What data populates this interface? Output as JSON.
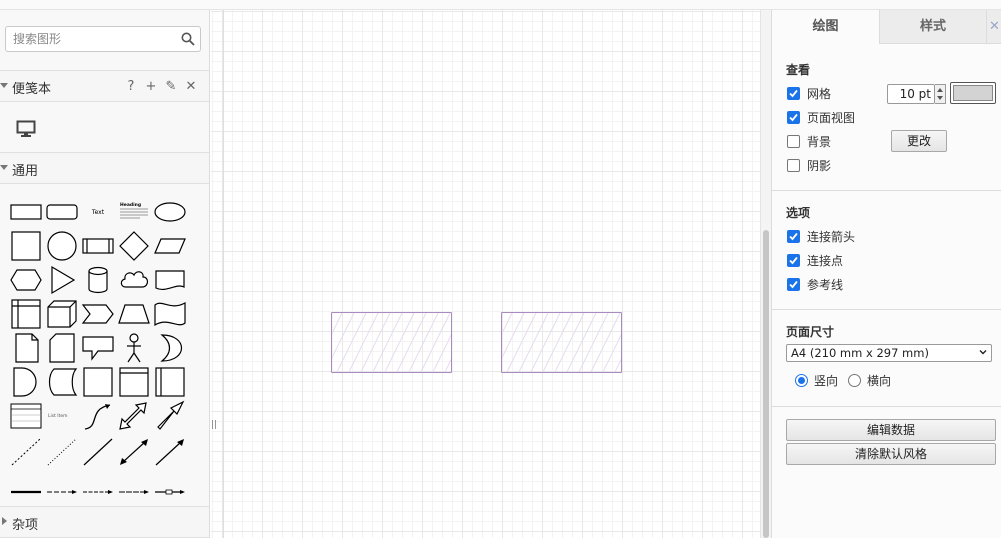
{
  "sidebar": {
    "search_placeholder": "搜索图形",
    "scratchpad": {
      "title": "便笺本",
      "help": "?",
      "add": "+",
      "edit": "✎",
      "close": "✕"
    },
    "general": {
      "title": "通用"
    },
    "misc": {
      "title": "杂项"
    },
    "shape_labels": {
      "text": "Text",
      "heading": "Heading",
      "list": "List Item"
    }
  },
  "canvas": {
    "splitter": "||"
  },
  "format_panel": {
    "tabs": {
      "diagram": "绘图",
      "style": "样式",
      "close": "✕"
    },
    "view": {
      "title": "查看",
      "grid_label": "网格",
      "grid_size": "10 pt",
      "grid_checked": true,
      "grid_color": "#d3d3d3",
      "page_view_label": "页面视图",
      "page_view_checked": true,
      "background_label": "背景",
      "background_checked": false,
      "change_button": "更改",
      "shadow_label": "阴影",
      "shadow_checked": false
    },
    "options": {
      "title": "选项",
      "connection_arrows": "连接箭头",
      "connection_points": "连接点",
      "guides": "参考线"
    },
    "paper": {
      "title": "页面尺寸",
      "size": "A4 (210 mm x 297 mm)",
      "portrait": "竖向",
      "landscape": "横向",
      "orientation": "portrait"
    },
    "actions": {
      "edit_data": "编辑数据",
      "clear_style": "清除默认风格"
    }
  },
  "colors": {
    "accent": "#1a73e8",
    "sketch_stroke": "#a98bc0"
  }
}
